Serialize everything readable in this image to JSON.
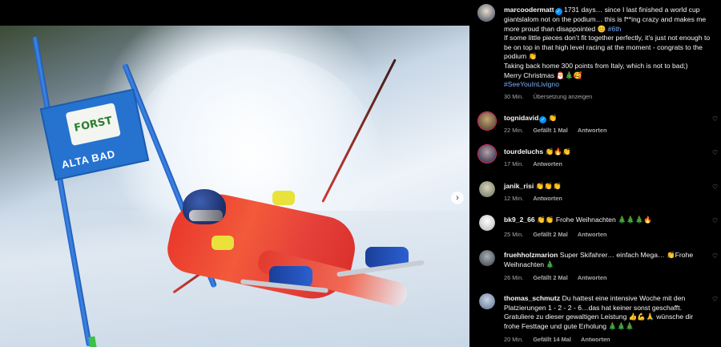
{
  "post": {
    "nav_next_symbol": "›",
    "gate_banner": {
      "logo_text": "FORST",
      "text": "ALTA BAD"
    }
  },
  "caption": {
    "username": "marcoodermatt",
    "verified": true,
    "line1": "1731 days… since I last finished a world cup giantslalom not on the podium… this is f**ing crazy and makes me more proud than disappointed 😊",
    "line1_tag": "#6th",
    "line2": "If some little pieces don’t fit together perfectly, it’s just not enough to be on top in that high level racing at the moment - congrats to the podium 👏",
    "line3": "Taking back home 300 points from Italy, which is not to bad;)",
    "line4": "Merry Christmas 🎅🎄🥰",
    "line5_tag": "#SeeYouInLivigno",
    "time": "30 Min.",
    "translate": "Übersetzung anzeigen"
  },
  "comments": [
    {
      "username": "tognidavid",
      "verified": true,
      "text": "👏",
      "time": "22 Min.",
      "likes": "Gefällt 1 Mal",
      "reply": "Antworten",
      "avatar_color": "#6b5a3a",
      "story_ring": true
    },
    {
      "username": "tourdeluchs",
      "verified": false,
      "text": "👏🔥👏",
      "time": "17 Min.",
      "likes": "",
      "reply": "Antworten",
      "avatar_color": "#4a4a60",
      "story_ring": true
    },
    {
      "username": "janik_risi",
      "verified": false,
      "text": "👏👏👏",
      "time": "12 Min.",
      "likes": "",
      "reply": "Antworten",
      "avatar_color": "#8a8f7a",
      "story_ring": false
    },
    {
      "username": "bk9_2_66",
      "verified": false,
      "text": "👏👏 Frohe Weihnachten 🎄🎄🎄🔥",
      "time": "25 Min.",
      "likes": "Gefällt 2 Mal",
      "reply": "Antworten",
      "avatar_color": "#c9c9c9",
      "story_ring": false
    },
    {
      "username": "fruehholzmarion",
      "verified": false,
      "text": "Super Skifahrer… einfach Mega… 👏Frohe Weihnachten 🎄",
      "time": "26 Min.",
      "likes": "Gefällt 2 Mal",
      "reply": "Antworten",
      "avatar_color": "#5a5f66",
      "story_ring": false
    },
    {
      "username": "thomas_schmutz",
      "verified": false,
      "text": "Du hattest eine intensive Woche mit den Platzierungen 1 - 2 - 2 - 6…das hat keiner sonst geschafft. Gratuliere zu dieser gewaltigen Leistung 👍💪🙏 wünsche dir frohe Festtage und gute Erholung 🎄🎄🎄",
      "time": "20 Min.",
      "likes": "Gefällt 14 Mal",
      "reply": "Antworten",
      "avatar_color": "#7b8fa8",
      "story_ring": false
    }
  ],
  "icons": {
    "heart": "heart-outline-icon",
    "verified": "verified-badge-icon",
    "next": "chevron-right-icon"
  }
}
